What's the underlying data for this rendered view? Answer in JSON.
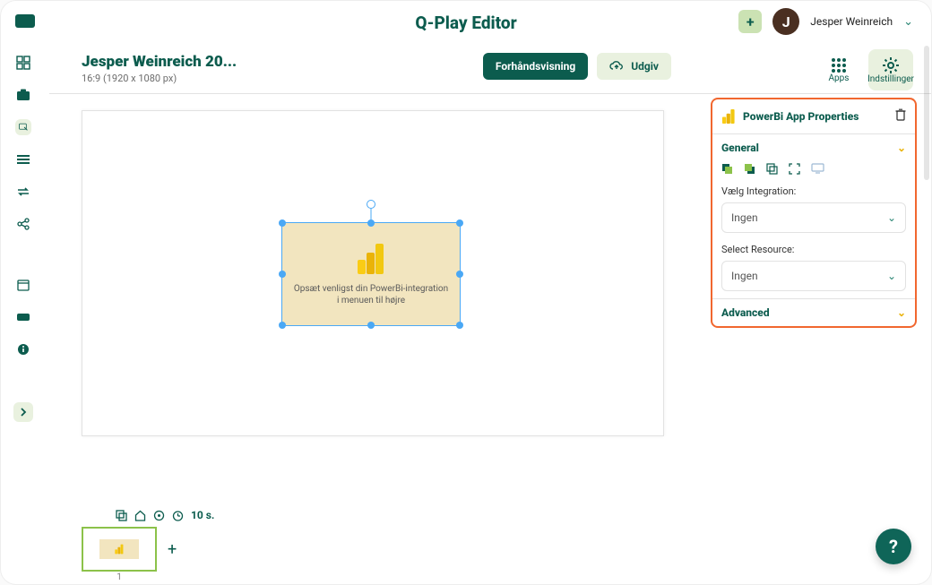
{
  "header": {
    "app_title": "Q-Play Editor",
    "user_name": "Jesper Weinreich",
    "avatar_initial": "J"
  },
  "document": {
    "title": "Jesper Weinreich 20...",
    "subtitle": "16:9 (1920 x 1080 px)",
    "preview_label": "Forhåndsvisning",
    "publish_label": "Udgiv"
  },
  "mode_tabs": {
    "apps": "Apps",
    "settings": "Indstillinger"
  },
  "canvas": {
    "widget_text_line1": "Opsæt venligst din PowerBi-integration",
    "widget_text_line2": "i menuen til højre"
  },
  "timeline": {
    "duration": "10 s.",
    "slide_number": "1"
  },
  "props": {
    "title": "PowerBi App Properties",
    "general_label": "General",
    "integration_label": "Vælg Integration:",
    "integration_value": "Ingen",
    "resource_label": "Select Resource:",
    "resource_value": "Ingen",
    "advanced_label": "Advanced"
  },
  "icons": {
    "plus": "+",
    "help": "?"
  }
}
